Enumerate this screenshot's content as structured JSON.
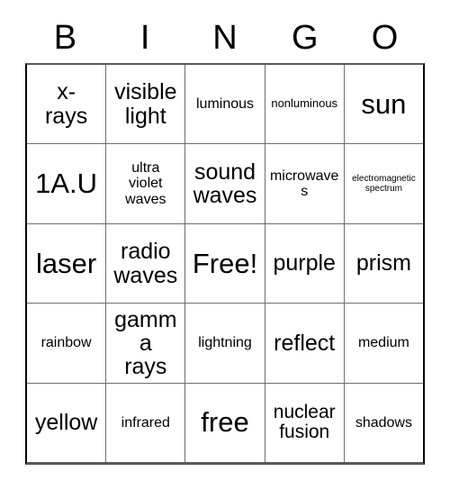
{
  "card": {
    "title": "BINGO",
    "header_letters": [
      "B",
      "I",
      "N",
      "G",
      "O"
    ],
    "free_space": {
      "row": 3,
      "column": 3,
      "label": "Free!"
    },
    "colors": {
      "background": "#ffffff",
      "text": "#000000",
      "grid_line": "#6e6e6e",
      "outer_border": "#000000"
    },
    "grid_size": "5x5",
    "rows": [
      {
        "cells": [
          {
            "text": "x-\nrays",
            "size": "fs-xl"
          },
          {
            "text": "visible\nlight",
            "size": "fs-xl"
          },
          {
            "text": "luminous",
            "size": "fs-md"
          },
          {
            "text": "nonluminous",
            "size": "fs-sm"
          },
          {
            "text": "sun",
            "size": "fs-xxl"
          }
        ]
      },
      {
        "cells": [
          {
            "text": "1A.U",
            "size": "fs-xxl"
          },
          {
            "text": "ultra\nviolet\nwaves",
            "size": "fs-md"
          },
          {
            "text": "sound\nwaves",
            "size": "fs-xl"
          },
          {
            "text": "microwaves",
            "size": "fs-md"
          },
          {
            "text": "electromagnetic\nspectrum",
            "size": "fs-xs"
          }
        ]
      },
      {
        "cells": [
          {
            "text": "laser",
            "size": "fs-xxl"
          },
          {
            "text": "radio\nwaves",
            "size": "fs-xl"
          },
          {
            "text": "Free!",
            "size": "fs-xxl"
          },
          {
            "text": "purple",
            "size": "fs-xl"
          },
          {
            "text": "prism",
            "size": "fs-xl"
          }
        ]
      },
      {
        "cells": [
          {
            "text": "rainbow",
            "size": "fs-md"
          },
          {
            "text": "gamma\nrays",
            "size": "fs-xl"
          },
          {
            "text": "lightning",
            "size": "fs-md"
          },
          {
            "text": "reflect",
            "size": "fs-xl"
          },
          {
            "text": "medium",
            "size": "fs-md"
          }
        ]
      },
      {
        "cells": [
          {
            "text": "yellow",
            "size": "fs-xl"
          },
          {
            "text": "infrared",
            "size": "fs-md"
          },
          {
            "text": "free",
            "size": "fs-xxl"
          },
          {
            "text": "nuclear\nfusion",
            "size": "fs-lg"
          },
          {
            "text": "shadows",
            "size": "fs-md"
          }
        ]
      }
    ]
  }
}
